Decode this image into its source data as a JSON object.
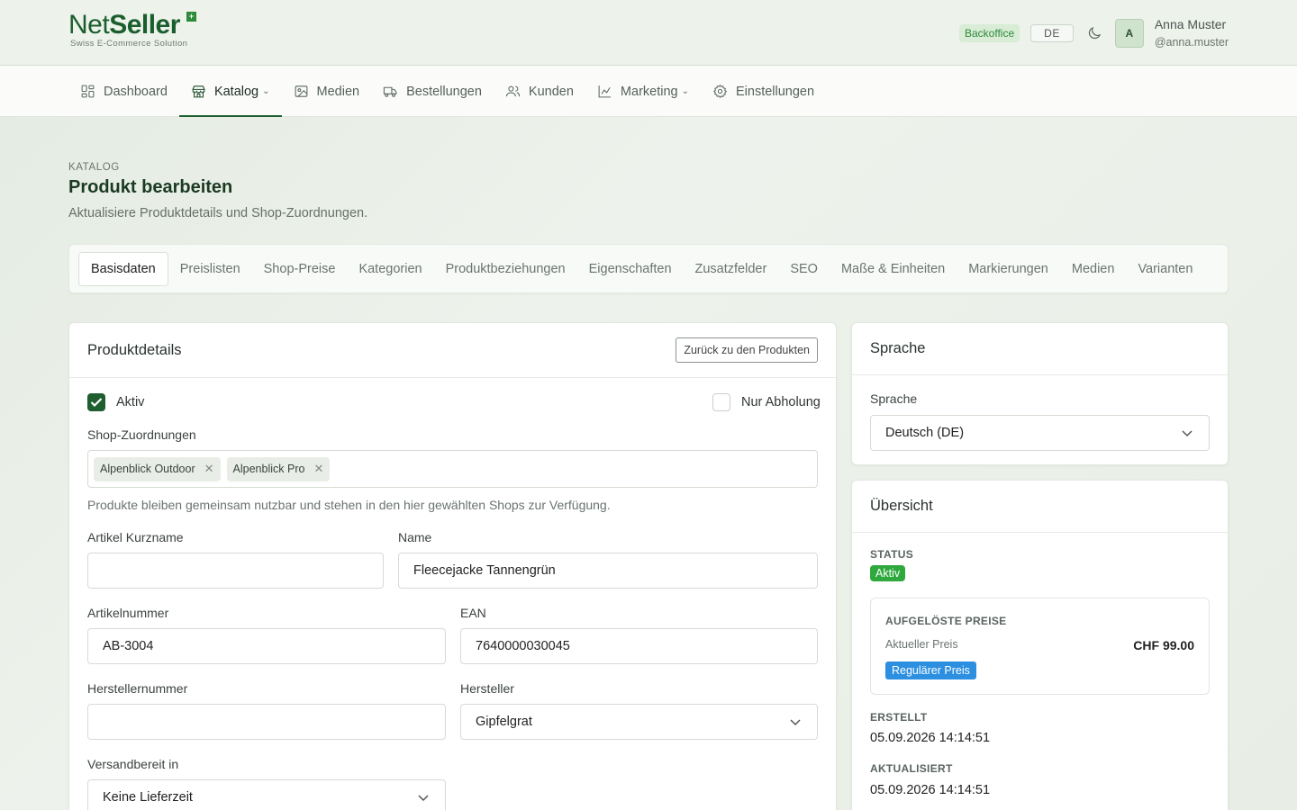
{
  "header": {
    "logo_net": "Net",
    "logo_seller": "Seller",
    "logo_tagline": "Swiss E-Commerce Solution",
    "logo_badge": "+",
    "env_badge": "Backoffice",
    "language_button": "DE",
    "user": {
      "avatar_initial": "A",
      "name": "Anna Muster",
      "handle": "@anna.muster"
    }
  },
  "nav": {
    "items": [
      {
        "label": "Dashboard",
        "icon": "grid-icon"
      },
      {
        "label": "Katalog",
        "icon": "store-icon",
        "dropdown": true,
        "active": true
      },
      {
        "label": "Medien",
        "icon": "image-icon"
      },
      {
        "label": "Bestellungen",
        "icon": "truck-icon"
      },
      {
        "label": "Kunden",
        "icon": "users-icon"
      },
      {
        "label": "Marketing",
        "icon": "chart-icon",
        "dropdown": true
      },
      {
        "label": "Einstellungen",
        "icon": "gear-icon"
      }
    ]
  },
  "page": {
    "kicker": "KATALOG",
    "title": "Produkt bearbeiten",
    "subtitle": "Aktualisiere Produktdetails und Shop-Zuordnungen."
  },
  "tabs": [
    "Basisdaten",
    "Preislisten",
    "Shop-Preise",
    "Kategorien",
    "Produktbeziehungen",
    "Eigenschaften",
    "Zusatzfelder",
    "SEO",
    "Maße & Einheiten",
    "Markierungen",
    "Medien",
    "Varianten"
  ],
  "details": {
    "title": "Produktdetails",
    "back_button": "Zurück zu den Produkten",
    "active_label": "Aktiv",
    "pickup_label": "Nur Abholung",
    "shops_label": "Shop-Zuordnungen",
    "shops": [
      "Alpenblick Outdoor",
      "Alpenblick Pro"
    ],
    "shops_help": "Produkte bleiben gemeinsam nutzbar und stehen in den hier gewählten Shops zur Verfügung.",
    "short_name_label": "Artikel Kurzname",
    "short_name_value": "",
    "name_label": "Name",
    "name_value": "Fleecejacke Tannengrün",
    "sku_label": "Artikelnummer",
    "sku_value": "AB-3004",
    "ean_label": "EAN",
    "ean_value": "7640000030045",
    "mpn_label": "Herstellernummer",
    "mpn_value": "",
    "manufacturer_label": "Hersteller",
    "manufacturer_value": "Gipfelgrat",
    "shipping_label": "Versandbereit in",
    "shipping_value": "Keine Lieferzeit"
  },
  "language_card": {
    "title": "Sprache",
    "label": "Sprache",
    "value": "Deutsch (DE)"
  },
  "overview": {
    "title": "Übersicht",
    "status_label": "STATUS",
    "status_value": "Aktiv",
    "prices_label": "AUFGELÖSTE PREISE",
    "current_price_label": "Aktueller Preis",
    "current_price_value": "CHF 99.00",
    "price_type": "Regulärer Preis",
    "created_label": "ERSTELLT",
    "created_value": "05.09.2026 14:14:51",
    "updated_label": "AKTUALISIERT",
    "updated_value": "05.09.2026 14:14:51"
  },
  "colors": {
    "brand_green": "#1f5e2e",
    "status_green": "#2fa83d",
    "price_blue": "#2c8fe0"
  }
}
